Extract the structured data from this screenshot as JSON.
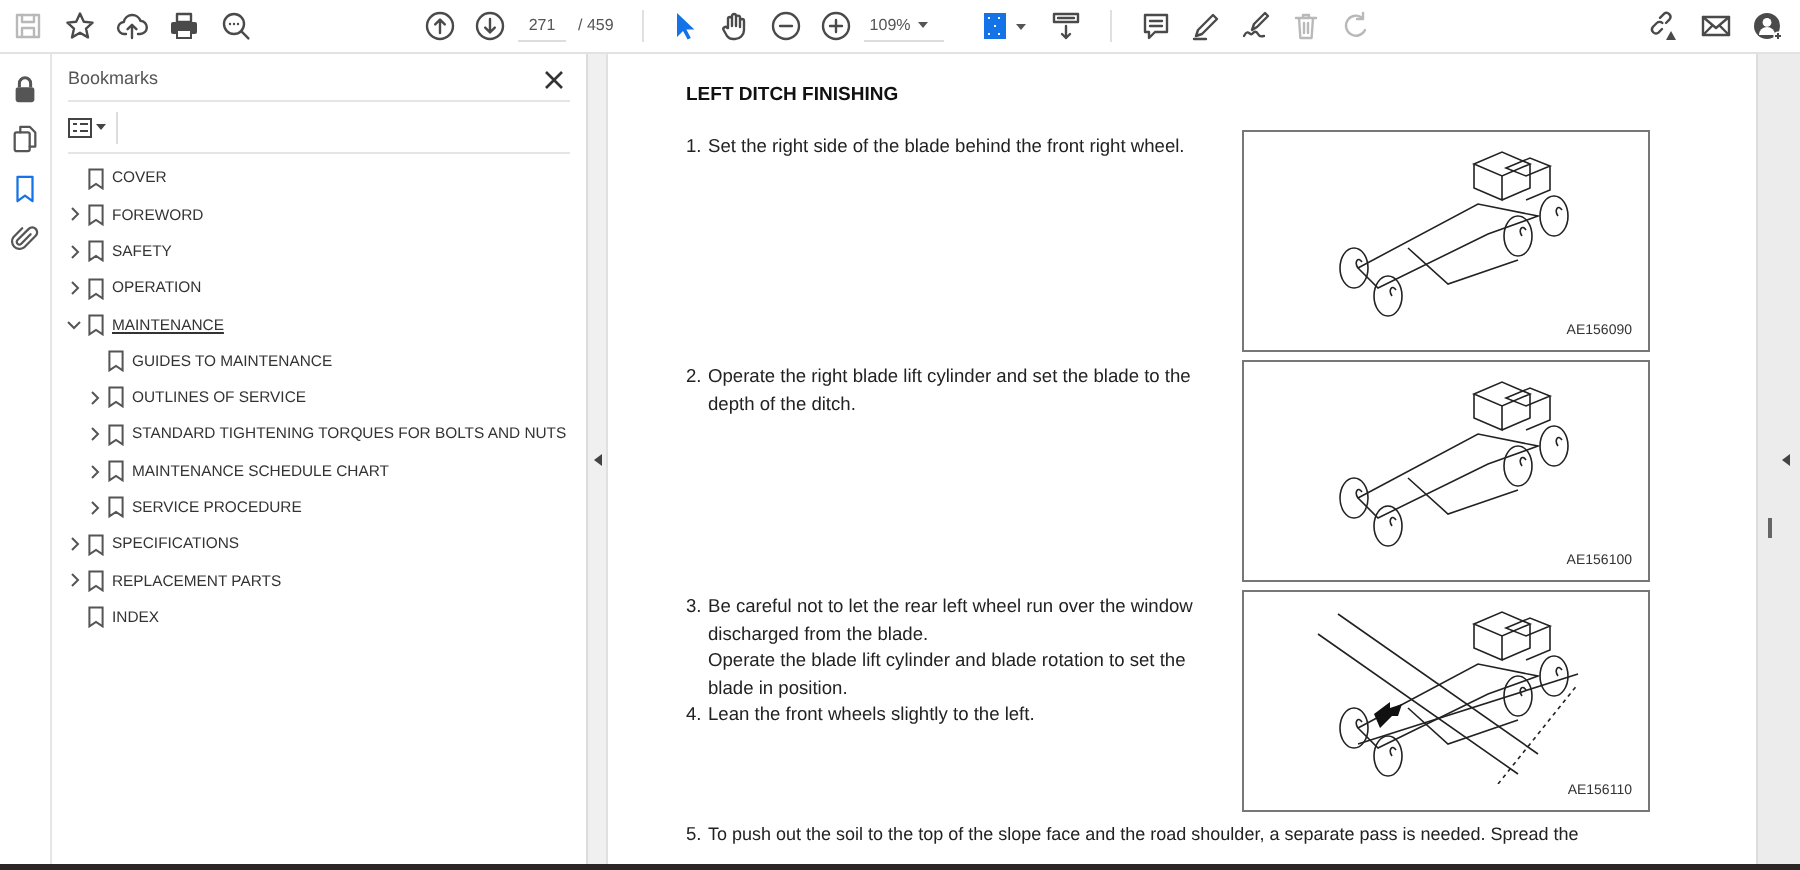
{
  "toolbar": {
    "left": [
      {
        "kind": "save",
        "disabled": true
      },
      {
        "kind": "star",
        "disabled": false
      },
      {
        "kind": "upload",
        "disabled": false
      },
      {
        "kind": "print",
        "disabled": false
      },
      {
        "kind": "find",
        "disabled": false
      }
    ],
    "page": {
      "current": "271",
      "total": "/ 459"
    },
    "tools": [
      {
        "kind": "select",
        "selected": true
      },
      {
        "kind": "hand",
        "selected": false
      }
    ],
    "zoom": {
      "value": "109%"
    },
    "edit": [
      {
        "kind": "comment",
        "disabled": false
      },
      {
        "kind": "highlight",
        "disabled": false
      },
      {
        "kind": "sign",
        "disabled": false
      },
      {
        "kind": "delete",
        "disabled": true
      },
      {
        "kind": "redo",
        "disabled": true
      }
    ],
    "right": [
      {
        "kind": "share",
        "disabled": false
      },
      {
        "kind": "mail",
        "disabled": false
      },
      {
        "kind": "account",
        "disabled": false
      }
    ]
  },
  "rail": [
    {
      "kind": "lock",
      "selected": false
    },
    {
      "kind": "pages",
      "selected": false
    },
    {
      "kind": "bookmarks",
      "selected": true
    },
    {
      "kind": "attachments",
      "selected": false
    }
  ],
  "bookmarks": {
    "title": "Bookmarks",
    "items": [
      {
        "kind": "leaf",
        "label": "COVER",
        "selected": false
      },
      {
        "kind": "group",
        "label": "FOREWORD",
        "expanded": false,
        "selected": false
      },
      {
        "kind": "group",
        "label": "SAFETY",
        "expanded": false,
        "selected": false
      },
      {
        "kind": "group",
        "label": "OPERATION",
        "expanded": false,
        "selected": false
      },
      {
        "kind": "group",
        "label": "MAINTENANCE",
        "expanded": true,
        "selected": true,
        "children": [
          {
            "kind": "leaf",
            "label": "GUIDES TO MAINTENANCE",
            "selected": false
          },
          {
            "kind": "group",
            "label": "OUTLINES OF SERVICE",
            "expanded": false,
            "selected": false
          },
          {
            "kind": "group",
            "label": "STANDARD TIGHTENING TORQUES FOR BOLTS AND NUTS",
            "expanded": false,
            "selected": false
          },
          {
            "kind": "group",
            "label": "MAINTENANCE SCHEDULE CHART",
            "expanded": false,
            "selected": false
          },
          {
            "kind": "group",
            "label": "SERVICE PROCEDURE",
            "expanded": false,
            "selected": false
          }
        ]
      },
      {
        "kind": "group",
        "label": "SPECIFICATIONS",
        "expanded": false,
        "selected": false
      },
      {
        "kind": "group",
        "label": "REPLACEMENT PARTS",
        "expanded": false,
        "selected": false
      },
      {
        "kind": "leaf",
        "label": "INDEX",
        "selected": false
      }
    ]
  },
  "document": {
    "heading": "LEFT DITCH FINISHING",
    "rows": [
      {
        "steps": [
          {
            "number": "1.",
            "paragraphs": [
              "Set the right side of the blade behind the front right wheel."
            ]
          }
        ],
        "figure": {
          "kind": "grader",
          "code": "AE156090"
        }
      },
      {
        "steps": [
          {
            "number": "2.",
            "paragraphs": [
              "Operate the right blade lift cylinder and set the blade to the depth of the ditch."
            ]
          }
        ],
        "figure": {
          "kind": "grader",
          "code": "AE156100"
        }
      },
      {
        "steps": [
          {
            "number": "3.",
            "paragraphs": [
              "Be careful not to let the rear left wheel run over the window discharged from the blade.",
              "Operate the blade lift cylinder and blade rotation to set the blade in position."
            ]
          },
          {
            "number": "4.",
            "paragraphs": [
              "Lean the front wheels slightly to the left."
            ]
          }
        ],
        "figure": {
          "kind": "grader-on-slope",
          "code": "AE156110"
        }
      },
      {
        "steps": [
          {
            "number": "5.",
            "paragraphs": [
              "To push out the soil to the top of the slope face and the road shoulder, a separate pass is needed. Spread the"
            ]
          }
        ]
      }
    ]
  }
}
